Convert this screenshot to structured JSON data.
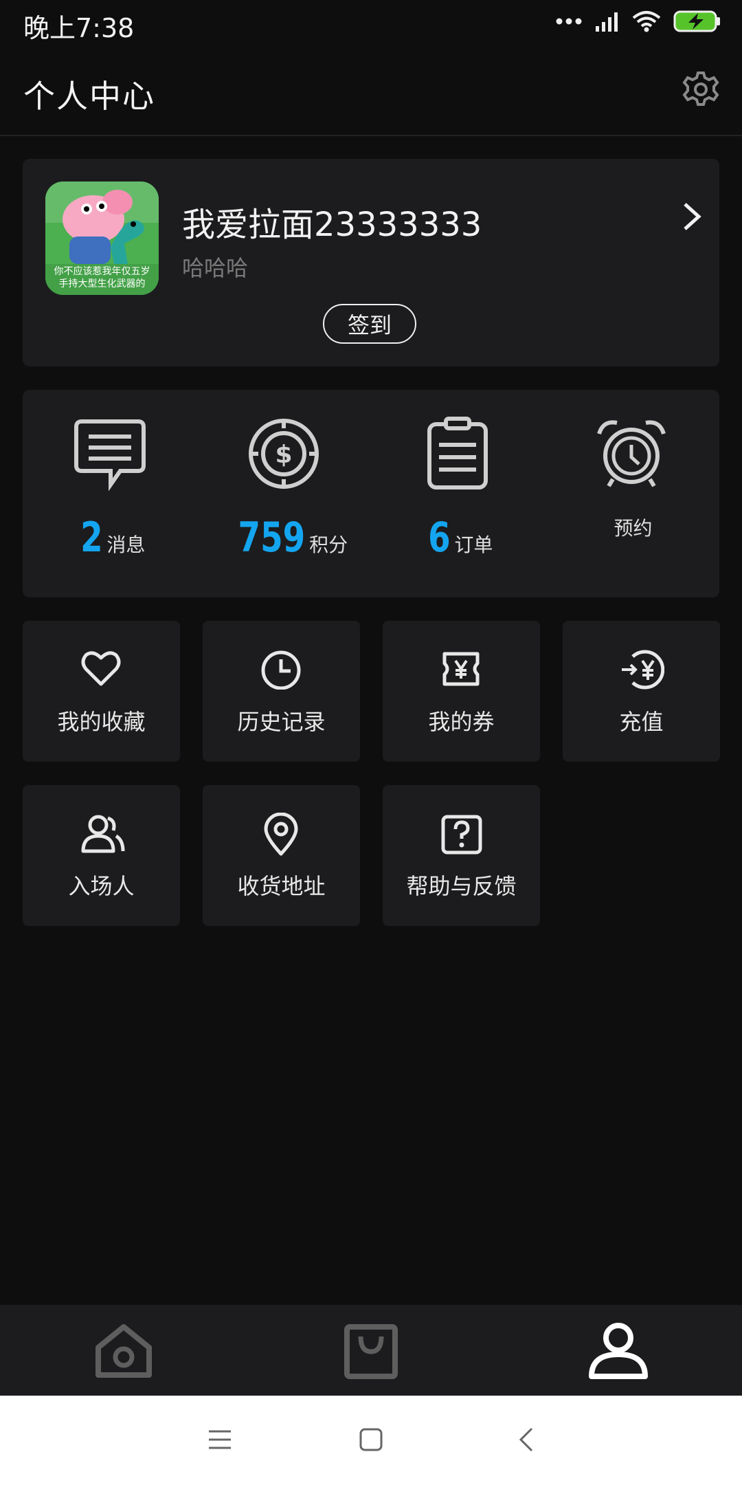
{
  "status_bar": {
    "time": "晚上7:38",
    "icons": [
      "more-dots-icon",
      "signal-icon",
      "wifi-icon",
      "battery-charging-icon"
    ]
  },
  "header": {
    "title": "个人中心",
    "settings_icon": "gear-icon"
  },
  "profile": {
    "avatar_alt": "avatar",
    "avatar_caption_1": "你不应该惹我年仅五岁",
    "avatar_caption_2": "手持大型生化武器的",
    "username": "我爱拉面23333333",
    "signature": "哈哈哈",
    "signin_label": "签到"
  },
  "stats": [
    {
      "icon": "message-icon",
      "count": "2",
      "label": "消息"
    },
    {
      "icon": "coin-icon",
      "count": "759",
      "label": "积分"
    },
    {
      "icon": "order-clipboard-icon",
      "count": "6",
      "label": "订单"
    },
    {
      "icon": "alarm-clock-icon",
      "count": "",
      "label": "预约"
    }
  ],
  "grid": [
    {
      "icon": "heart-icon",
      "label": "我的收藏"
    },
    {
      "icon": "clock-icon",
      "label": "历史记录"
    },
    {
      "icon": "coupon-icon",
      "label": "我的券"
    },
    {
      "icon": "recharge-icon",
      "label": "充值"
    },
    {
      "icon": "attendee-icon",
      "label": "入场人"
    },
    {
      "icon": "location-pin-icon",
      "label": "收货地址"
    },
    {
      "icon": "help-icon",
      "label": "帮助与反馈"
    }
  ],
  "tabbar": {
    "items": [
      "home-tab",
      "shop-tab",
      "profile-tab"
    ],
    "active": "profile-tab"
  },
  "colors": {
    "accent": "#14a5f0",
    "background": "#0e0e0f",
    "card": "#1c1c1e"
  }
}
